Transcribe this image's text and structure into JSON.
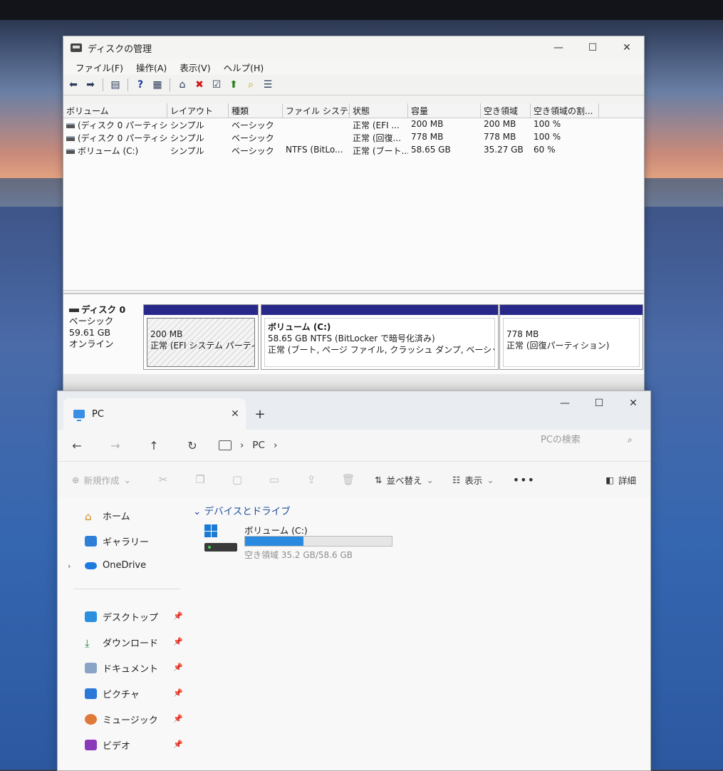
{
  "disk_mgmt": {
    "title": "ディスクの管理",
    "menus": [
      "ファイル(F)",
      "操作(A)",
      "表示(V)",
      "ヘルプ(H)"
    ],
    "columns": [
      "ボリューム",
      "レイアウト",
      "種類",
      "ファイル システム",
      "状態",
      "容量",
      "空き領域",
      "空き領域の割..."
    ],
    "rows": [
      [
        "(ディスク 0 パーティシ...",
        "シンプル",
        "ベーシック",
        "",
        "正常 (EFI ...",
        "200 MB",
        "200 MB",
        "100 %"
      ],
      [
        "(ディスク 0 パーティシ...",
        "シンプル",
        "ベーシック",
        "",
        "正常 (回復...",
        "778 MB",
        "778 MB",
        "100 %"
      ],
      [
        "ボリューム (C:)",
        "シンプル",
        "ベーシック",
        "NTFS (BitLo...",
        "正常 (ブート...",
        "58.65 GB",
        "35.27 GB",
        "60 %"
      ]
    ],
    "disk": {
      "name": "ディスク 0",
      "type": "ベーシック",
      "size": "59.61 GB",
      "status": "オンライン"
    },
    "partitions": [
      {
        "name": "",
        "size": "200 MB",
        "status": "正常 (EFI システム パーティシ"
      },
      {
        "name": "ボリューム (C:)",
        "size": "58.65 GB NTFS (BitLocker で暗号化済み)",
        "status": "正常 (ブート, ページ ファイル, クラッシュ ダンプ, ベーシック データ /"
      },
      {
        "name": "",
        "size": "778 MB",
        "status": "正常 (回復パーティション)"
      }
    ]
  },
  "explorer": {
    "tab_label": "PC",
    "new_tab": "+",
    "breadcrumb": [
      "PC"
    ],
    "search_placeholder": "PCの検索",
    "commands": {
      "new": "新規作成",
      "sort": "並べ替え",
      "view": "表示",
      "more": "•••",
      "details": "詳細"
    },
    "sidebar": {
      "items": [
        {
          "label": "ホーム",
          "icon": "home-icon"
        },
        {
          "label": "ギャラリー",
          "icon": "gallery-icon"
        },
        {
          "label": "OneDrive",
          "icon": "cloud-icon"
        },
        {
          "label": "デスクトップ",
          "icon": "desktop-icon"
        },
        {
          "label": "ダウンロード",
          "icon": "download-icon"
        },
        {
          "label": "ドキュメント",
          "icon": "document-icon"
        },
        {
          "label": "ピクチャ",
          "icon": "picture-icon"
        },
        {
          "label": "ミュージック",
          "icon": "music-icon"
        },
        {
          "label": "ビデオ",
          "icon": "video-icon"
        }
      ]
    },
    "group_header": "デバイスとドライブ",
    "drive": {
      "name": "ボリューム (C:)",
      "free_text": "空き領域 35.2 GB/58.6 GB",
      "used_fraction": 0.4
    }
  }
}
